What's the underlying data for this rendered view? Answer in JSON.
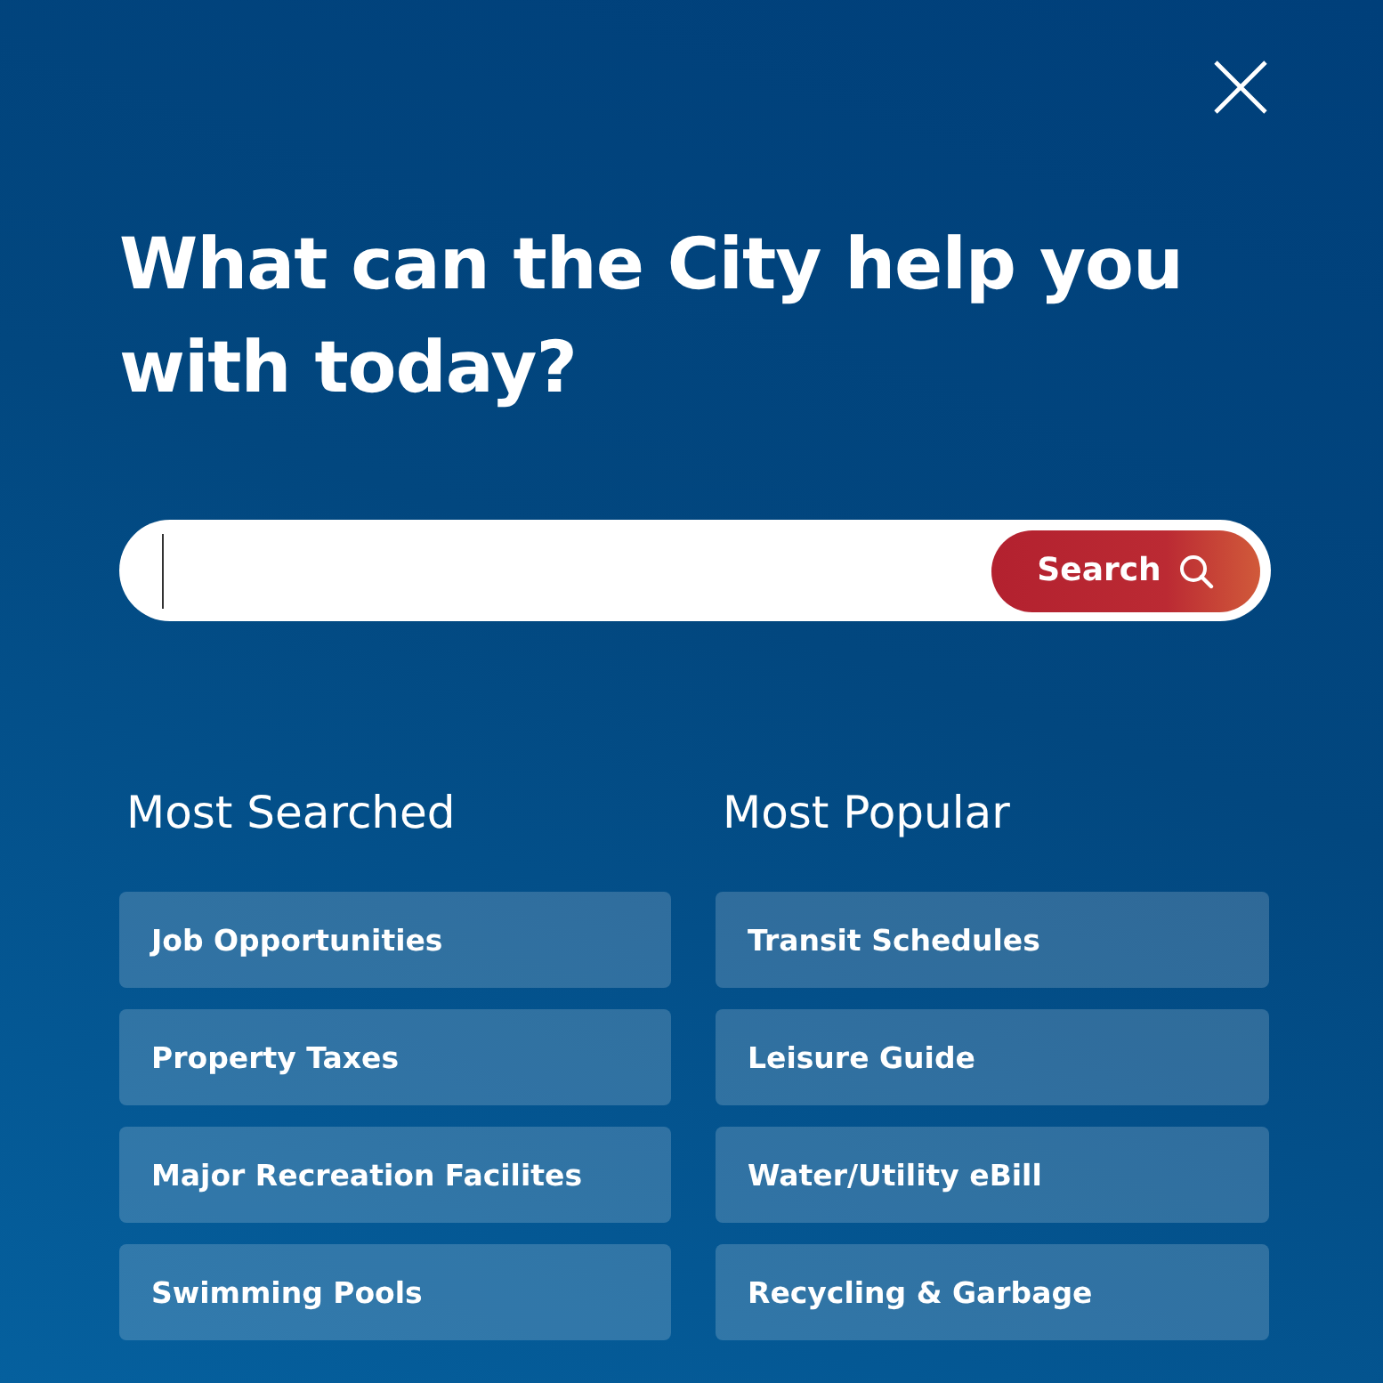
{
  "title": "What can the City help you with today?",
  "search": {
    "button": "Search"
  },
  "columns": [
    {
      "heading": "Most Searched",
      "links": [
        "Job Opportunities",
        "Property Taxes",
        "Major Recreation Facilites",
        "Swimming Pools"
      ]
    },
    {
      "heading": "Most Popular",
      "links": [
        "Transit Schedules",
        "Leisure Guide",
        "Water/Utility eBill",
        "Recycling & Garbage"
      ]
    }
  ]
}
